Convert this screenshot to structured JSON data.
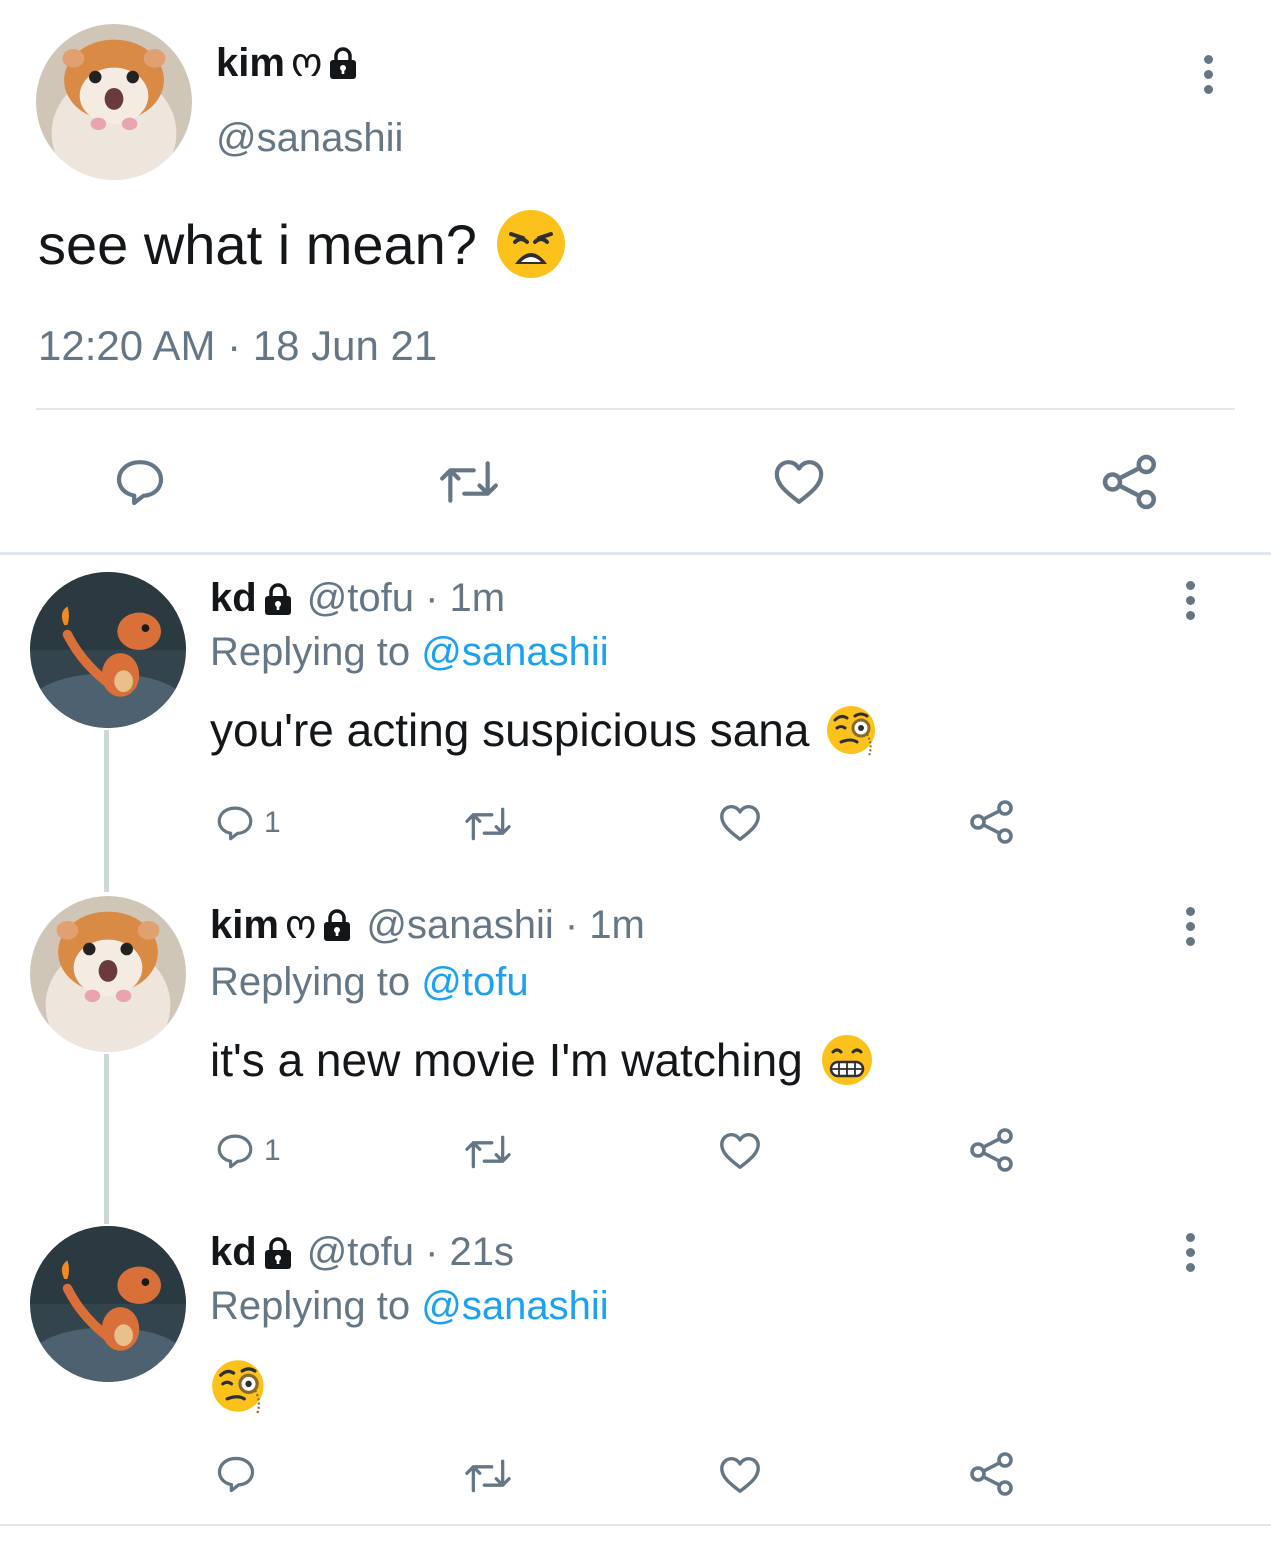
{
  "main_tweet": {
    "display_name": "kim",
    "name_symbol": "ო",
    "handle": "@sanashii",
    "text": "see what i mean?",
    "emoji": "weary-face",
    "timestamp": "12:20 AM · 18 Jun 21",
    "avatar": "hamster-avatar"
  },
  "replies": [
    {
      "display_name": "kd",
      "name_symbol": "",
      "handle_meta": "@tofu · 1m",
      "replying_prefix": "Replying to ",
      "replying_to": "@sanashii",
      "text": "you're acting suspicious sana",
      "emoji": "face-with-monocle",
      "reply_count": "1",
      "avatar": "charmander-avatar"
    },
    {
      "display_name": "kim",
      "name_symbol": "ო",
      "handle_meta": "@sanashii · 1m",
      "replying_prefix": "Replying to ",
      "replying_to": "@tofu",
      "text": "it's a new movie I'm watching",
      "emoji": "grimacing-face",
      "reply_count": "1",
      "avatar": "hamster-avatar"
    },
    {
      "display_name": "kd",
      "name_symbol": "",
      "handle_meta": "@tofu · 21s",
      "replying_prefix": "Replying to ",
      "replying_to": "@sanashii",
      "text": "",
      "emoji": "face-with-monocle",
      "reply_count": "",
      "avatar": "charmander-avatar"
    }
  ],
  "colors": {
    "text_primary": "#14171a",
    "text_secondary": "#657786",
    "link": "#1da1f2",
    "divider": "#e1e8ed",
    "thread_line": "#ccd6dd"
  }
}
